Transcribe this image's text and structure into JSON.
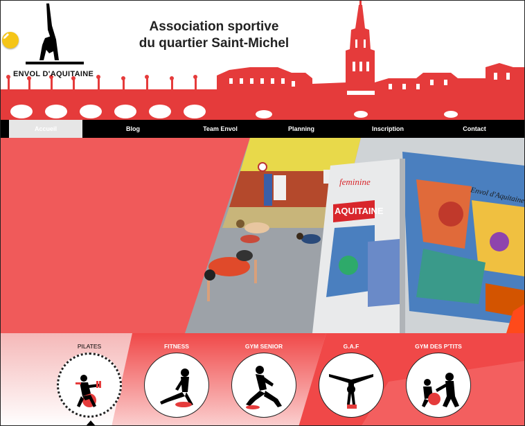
{
  "header": {
    "title_line1": "Association sportive",
    "title_line2": "du quartier Saint-Michel",
    "logo_text": "ENVOL D'AQUITAINE",
    "edit_icon": "pencil-icon"
  },
  "nav": {
    "items": [
      {
        "label": "Accueil",
        "active": true
      },
      {
        "label": "Blog",
        "active": false
      },
      {
        "label": "Team Envol",
        "active": false
      },
      {
        "label": "Planning",
        "active": false
      },
      {
        "label": "Inscription",
        "active": false
      },
      {
        "label": "Contact",
        "active": false
      }
    ]
  },
  "hero": {
    "wall_text_1": "feminine",
    "wall_text_2": "AQUITAINE",
    "mural_text": "Envol d'Aquitaine"
  },
  "activities": [
    {
      "label": "PILATES",
      "icon": "pilates-ball-icon",
      "active": true
    },
    {
      "label": "FITNESS",
      "icon": "fitness-stretch-icon",
      "active": false
    },
    {
      "label": "GYM SENIOR",
      "icon": "senior-lunge-icon",
      "active": false
    },
    {
      "label": "G.A.F",
      "icon": "gymnast-split-icon",
      "active": false
    },
    {
      "label": "GYM DES P'TITS",
      "icon": "kids-gym-icon",
      "active": false
    }
  ],
  "colors": {
    "accent_red": "#f04848",
    "nav_bg": "#000000",
    "nav_active_bg": "#e6e6e6",
    "edit_button": "#f5c518"
  }
}
